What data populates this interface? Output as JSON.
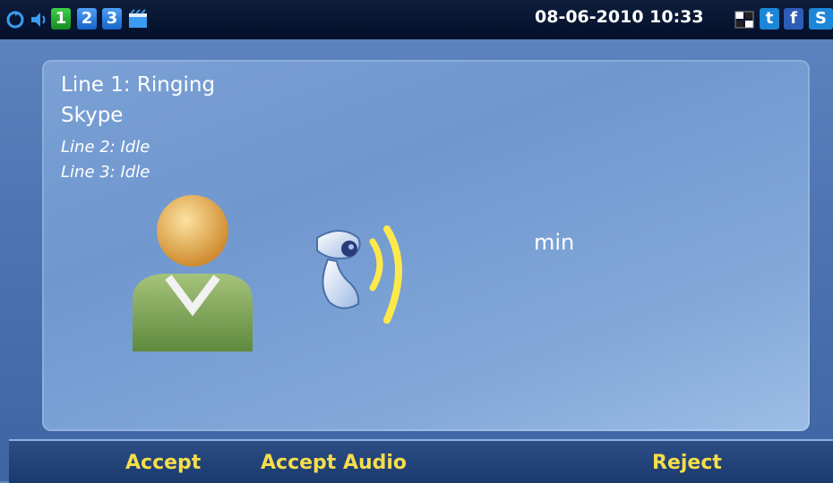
{
  "status_bar": {
    "icons": [
      "sync-icon",
      "speaker-icon",
      "board-icon",
      "grid-icon"
    ],
    "line_buttons": [
      "1",
      "2",
      "3"
    ],
    "datetime": "08-06-2010 10:33",
    "app_tiles": [
      "t",
      "f",
      "S"
    ]
  },
  "call": {
    "line1_status": "Line 1: Ringing",
    "service": "Skype",
    "line2_status": "Line 2: Idle",
    "line3_status": "Line 3: Idle",
    "duration_unit": "min",
    "caller_icon": "person-avatar-icon",
    "ringing_icon": "ringing-camera-icon"
  },
  "softkeys": {
    "accept": "Accept",
    "accept_audio": "Accept Audio",
    "reject": "Reject"
  },
  "colors": {
    "softkey_text": "#f5de4a",
    "line1_active": "#22a82e",
    "line_inactive": "#1f74de"
  }
}
